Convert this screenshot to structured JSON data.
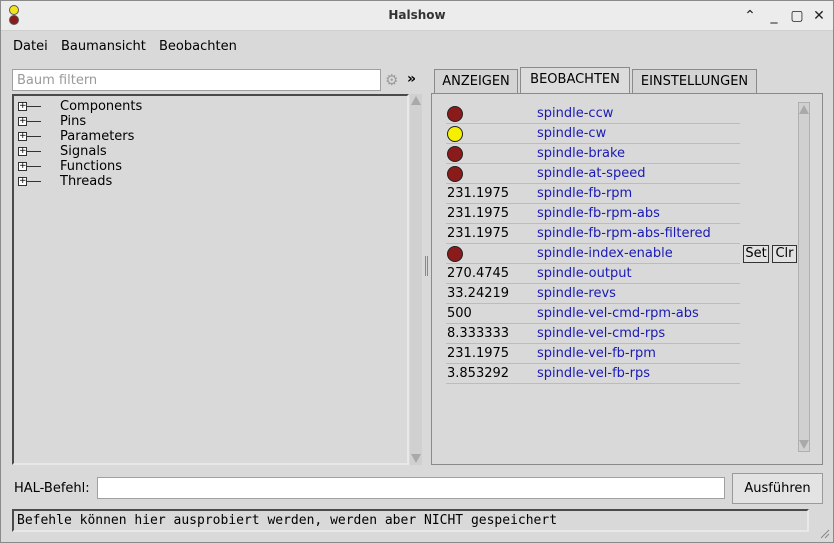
{
  "window": {
    "title": "Halshow"
  },
  "menubar": [
    "Datei",
    "Baumansicht",
    "Beobachten"
  ],
  "filter": {
    "placeholder": "Baum filtern",
    "more_label": "»"
  },
  "tree": {
    "items": [
      {
        "label": "Components"
      },
      {
        "label": "Pins"
      },
      {
        "label": "Parameters"
      },
      {
        "label": "Signals"
      },
      {
        "label": "Functions"
      },
      {
        "label": "Threads"
      }
    ]
  },
  "tabs": [
    {
      "label": "ANZEIGEN",
      "active": false
    },
    {
      "label": "BEOBACHTEN",
      "active": true
    },
    {
      "label": "EINSTELLUNGEN",
      "active": false
    }
  ],
  "colors": {
    "led_off": "#8b1a1a",
    "led_on": "#f5f000",
    "name": "#1a1ab4"
  },
  "watch": {
    "rows": [
      {
        "type": "led",
        "state": "off",
        "name": "spindle-ccw"
      },
      {
        "type": "led",
        "state": "on",
        "name": "spindle-cw"
      },
      {
        "type": "led",
        "state": "off",
        "name": "spindle-brake"
      },
      {
        "type": "led",
        "state": "off",
        "name": "spindle-at-speed"
      },
      {
        "type": "value",
        "value": "231.1975",
        "name": "spindle-fb-rpm"
      },
      {
        "type": "value",
        "value": "231.1975",
        "name": "spindle-fb-rpm-abs"
      },
      {
        "type": "value",
        "value": "231.1975",
        "name": "spindle-fb-rpm-abs-filtered"
      },
      {
        "type": "led",
        "state": "off",
        "name": "spindle-index-enable"
      },
      {
        "type": "value",
        "value": "270.4745",
        "name": "spindle-output"
      },
      {
        "type": "value",
        "value": "33.24219",
        "name": "spindle-revs"
      },
      {
        "type": "value",
        "value": "500",
        "name": "spindle-vel-cmd-rpm-abs"
      },
      {
        "type": "value",
        "value": "8.333333",
        "name": "spindle-vel-cmd-rps"
      },
      {
        "type": "value",
        "value": "231.1975",
        "name": "spindle-vel-fb-rpm"
      },
      {
        "type": "value",
        "value": "3.853292",
        "name": "spindle-vel-fb-rps"
      }
    ],
    "set_label": "Set",
    "clr_label": "Clr"
  },
  "command": {
    "label": "HAL-Befehl:",
    "value": "",
    "run_label": "Ausführen",
    "status": "Befehle können hier ausprobiert werden, werden aber NICHT gespeichert"
  }
}
